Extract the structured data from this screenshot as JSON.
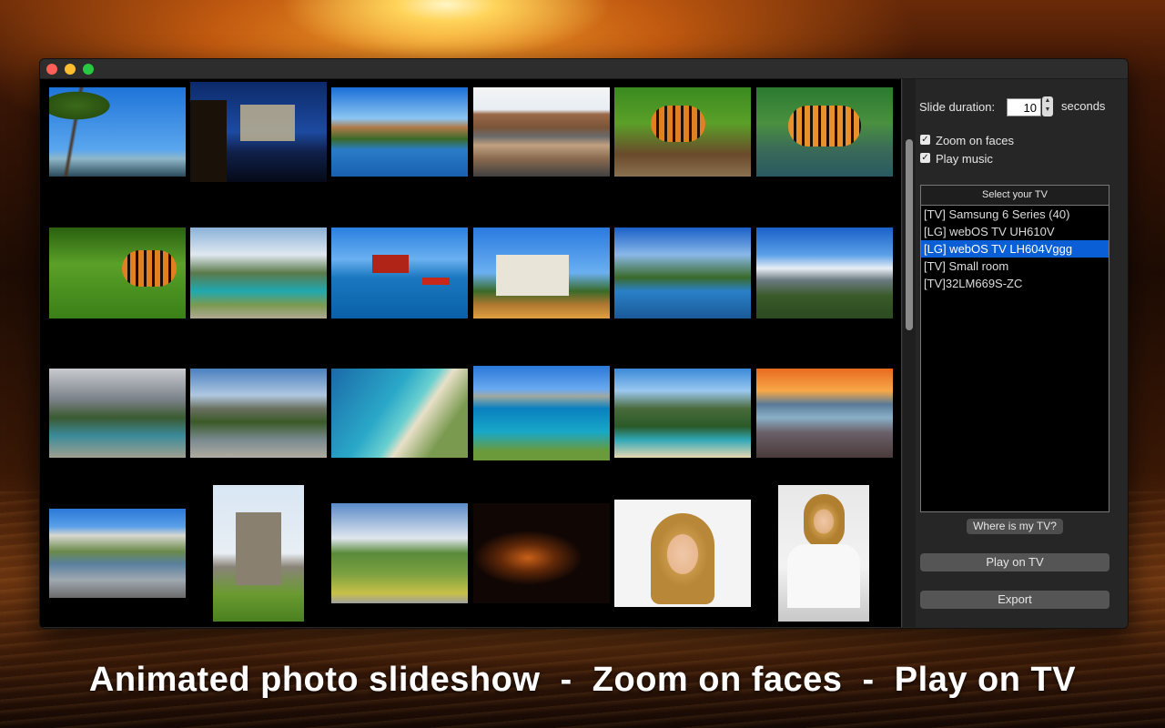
{
  "window": {
    "traffic_lights": [
      "close",
      "minimize",
      "zoom"
    ]
  },
  "settings": {
    "slide_duration_label": "Slide duration:",
    "slide_duration_value": "10",
    "slide_duration_unit": "seconds",
    "zoom_on_faces_label": "Zoom on faces",
    "zoom_on_faces_checked": true,
    "play_music_label": "Play music",
    "play_music_checked": true
  },
  "tv_list": {
    "header": "Select your TV",
    "items": [
      "[TV] Samsung 6 Series (40)",
      "[LG] webOS TV UH610V",
      "[LG] webOS TV LH604Vggg",
      "[TV] Small room",
      "[TV]32LM669S-ZC"
    ],
    "selected_index": 2
  },
  "buttons": {
    "where_tv": "Where is my TV?",
    "play_on_tv": "Play on TV",
    "export": "Export"
  },
  "photos": [
    "palm-beach",
    "castle-night",
    "mountain-lake",
    "canal-town",
    "tiger-log",
    "tiger-water",
    "tigers-grass",
    "river-path",
    "red-house-harbor",
    "neuschwanstein",
    "alpine-river",
    "snowy-mountains",
    "cloudy-river-path",
    "mountain-stream",
    "aerial-beach",
    "turquoise-bay",
    "coast-hills",
    "sunset-shore",
    "cliff-lake",
    "chateau",
    "country-road",
    "night-lights",
    "woman-portrait",
    "woman-desk"
  ],
  "caption": "Animated photo slideshow  -  Zoom on faces  -  Play on TV"
}
